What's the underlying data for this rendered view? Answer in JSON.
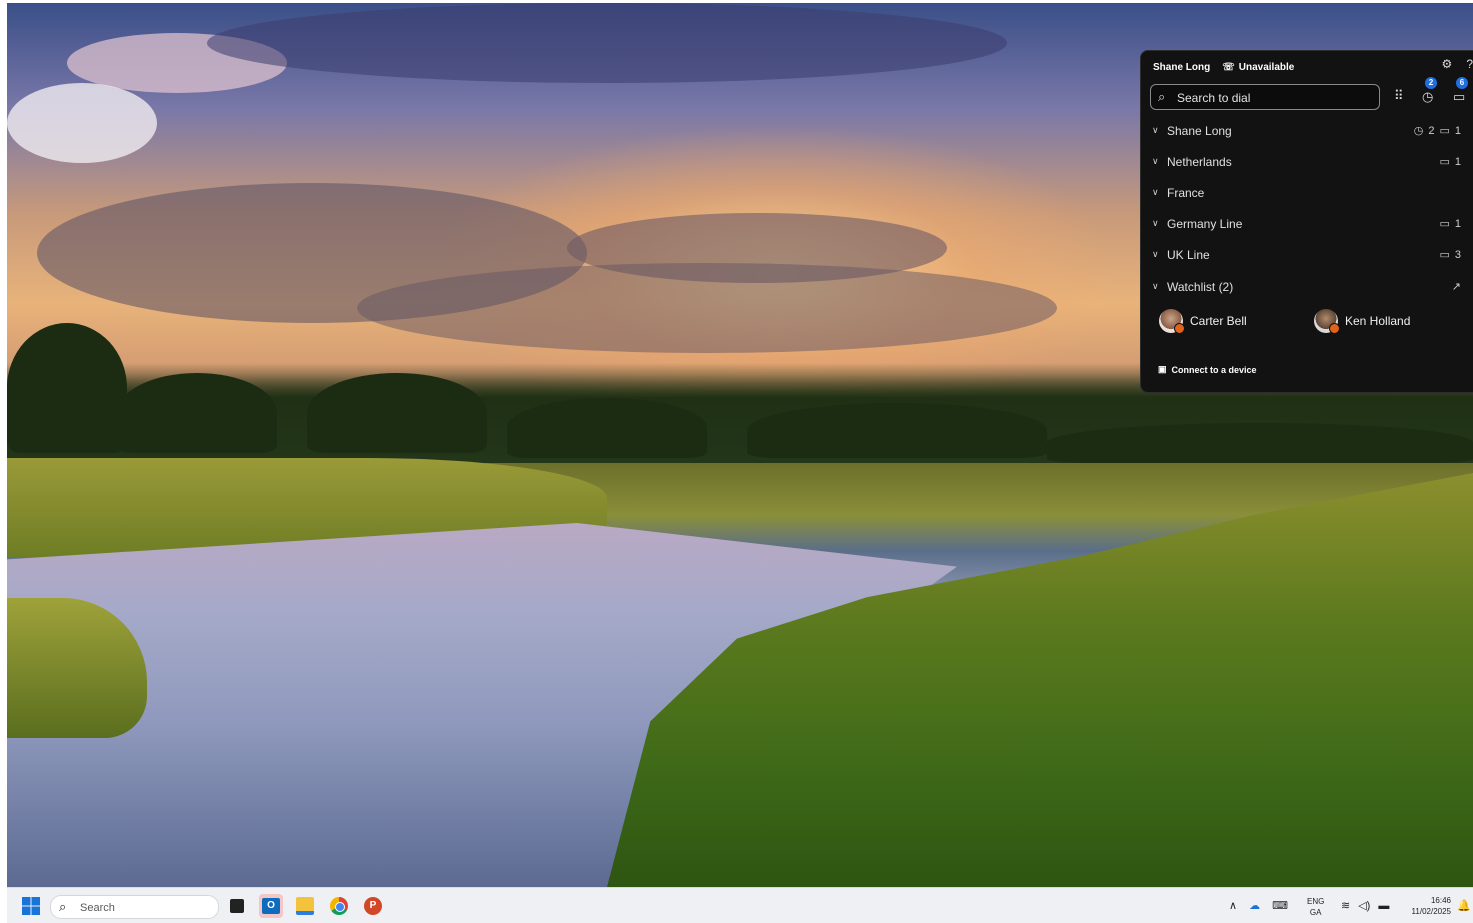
{
  "panel": {
    "user_name": "Shane Long",
    "status": "Unavailable",
    "search_placeholder": "Search to dial",
    "badges": {
      "history": "2",
      "voicemail": "6"
    },
    "lines": [
      {
        "label": "Shane Long",
        "missed": "2",
        "voicemail": "1"
      },
      {
        "label": "Netherlands",
        "voicemail": "1"
      },
      {
        "label": "France"
      },
      {
        "label": "Germany Line",
        "voicemail": "1"
      },
      {
        "label": "UK Line",
        "voicemail": "3"
      }
    ],
    "watchlist": {
      "label": "Watchlist (2)",
      "contacts": [
        "Carter Bell",
        "Ken Holland"
      ]
    },
    "connect_label": "Connect to a device"
  },
  "taskbar": {
    "search_placeholder": "Search",
    "language": "ENG",
    "layout": "GA",
    "time": "16:46",
    "date": "11/02/2025"
  },
  "colors": {
    "panel_bg": "#121212",
    "badge": "#1f6fe0",
    "presence": "#e0641a",
    "taskbar_bg": "#eef0f3"
  }
}
